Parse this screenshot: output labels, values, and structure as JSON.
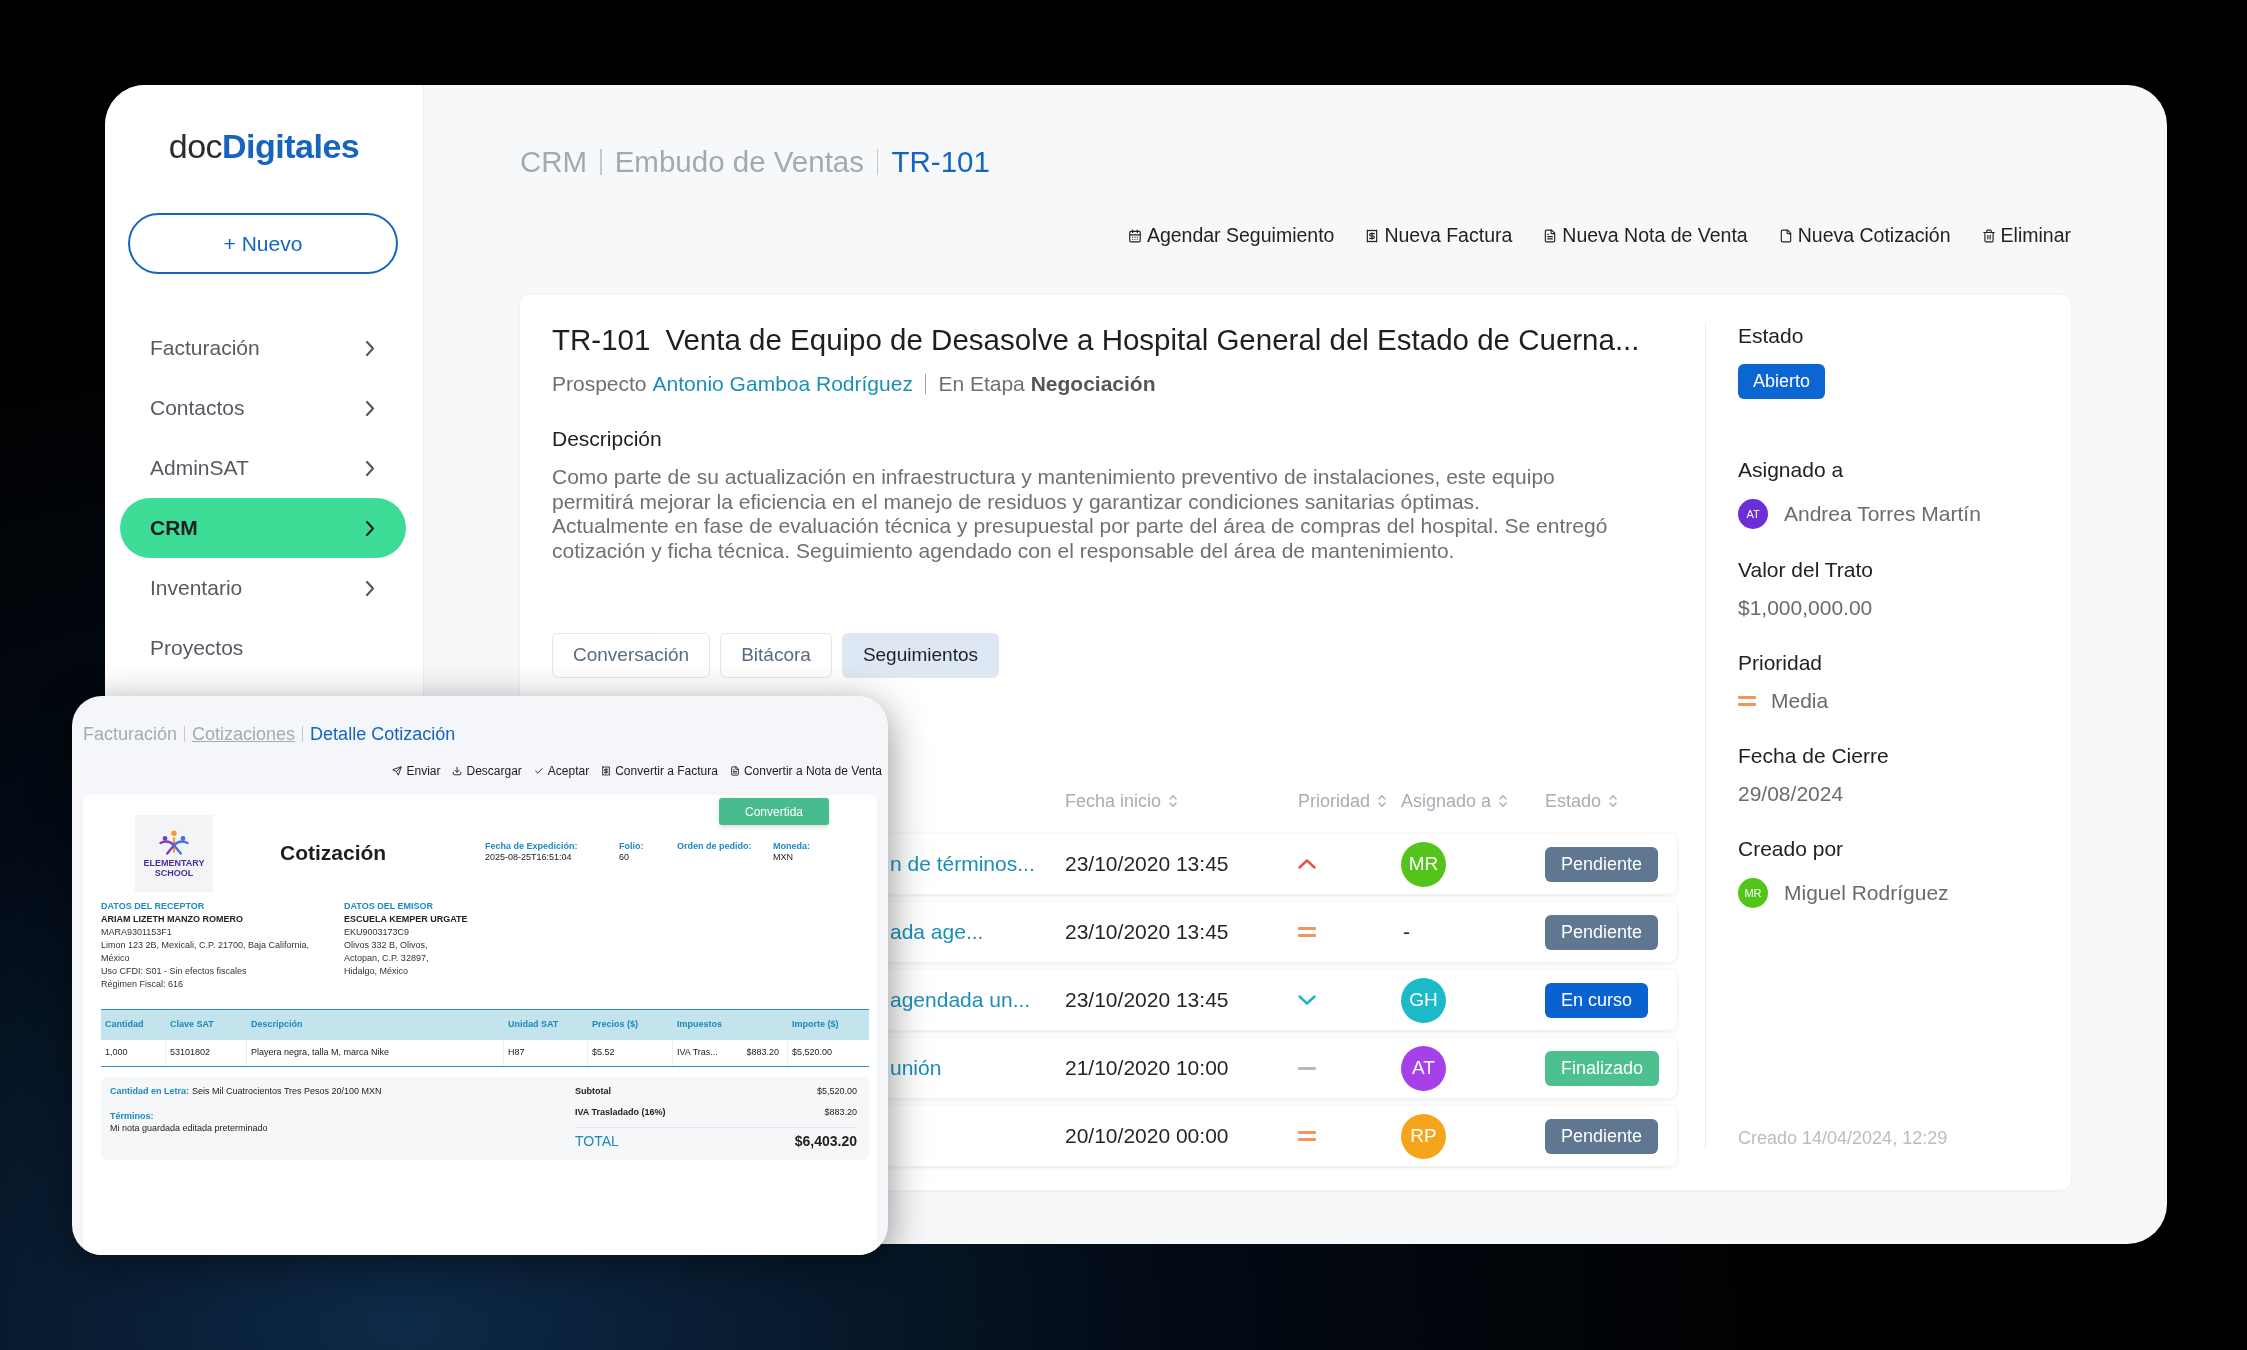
{
  "logo": {
    "text": "doc**Digitales**"
  },
  "new_button": {
    "label": "+ Nuevo"
  },
  "sidebar": {
    "items": [
      {
        "label": "Facturación",
        "submenu": true,
        "selected": false
      },
      {
        "label": "Contactos",
        "submenu": true,
        "selected": false
      },
      {
        "label": "AdminSAT",
        "submenu": true,
        "selected": false
      },
      {
        "label": "CRM",
        "submenu": true,
        "selected": true
      },
      {
        "label": "Inventario",
        "submenu": true,
        "selected": false
      },
      {
        "label": "Proyectos",
        "submenu": false,
        "selected": false
      }
    ]
  },
  "breadcrumb": [
    {
      "label": "CRM",
      "current": false
    },
    {
      "label": "Embudo de Ventas",
      "current": false
    },
    {
      "label": "TR-101",
      "current": true
    }
  ],
  "actions": [
    "Agendar Seguimiento",
    "Nueva Factura",
    "Nueva Nota de Venta",
    "Nueva Cotización",
    "Eliminar"
  ],
  "deal": {
    "code": "TR-101",
    "title": "Venta de Equipo de Desasolve a Hospital General del Estado de Cuerna...",
    "prospect_label": "Prospecto",
    "prospect": "Antonio Gamboa Rodríguez",
    "stage": "En Etapa **Negociación**",
    "description_label": "Descripción",
    "description": [
      "Como parte de su actualización en infraestructura y mantenimiento preventivo de instalaciones, este equipo permitirá mejorar la eficiencia en el manejo de residuos y garantizar condiciones sanitarias óptimas.",
      "Actualmente en fase de evaluación técnica y presupuestal por parte del área de compras del hospital. Se entregó cotización y ficha técnica. Seguimiento agendado con el responsable del área de mantenimiento."
    ]
  },
  "tabs": [
    {
      "label": "Conversación",
      "selected": false
    },
    {
      "label": "Bitácora",
      "selected": false
    },
    {
      "label": "Seguimientos",
      "selected": true
    }
  ],
  "followups": {
    "columns": [
      "Fecha inicio",
      "Prioridad",
      "Asignado a",
      "Estado"
    ],
    "rows": [
      {
        "title": "n de términos...",
        "start": "23/10/2020 13:45",
        "priority": {
          "kind": "high"
        },
        "assignee": {
          "kind": "avatar",
          "initials": "MR",
          "color": "#52c41a"
        },
        "status": {
          "label": "Pendiente",
          "color": "#5f7791"
        }
      },
      {
        "title": "ada age...",
        "start": "23/10/2020 13:45",
        "priority": {
          "kind": "medium"
        },
        "assignee": {
          "kind": "none",
          "text": "-"
        },
        "status": {
          "label": "Pendiente",
          "color": "#5f7791"
        }
      },
      {
        "title": "agendada un...",
        "start": "23/10/2020 13:45",
        "priority": {
          "kind": "low"
        },
        "assignee": {
          "kind": "avatar",
          "initials": "GH",
          "color": "#1cb9c8"
        },
        "status": {
          "label": "En curso",
          "color": "#0a62d0"
        }
      },
      {
        "title": "unión",
        "start": "21/10/2020 10:00",
        "priority": {
          "kind": "none"
        },
        "assignee": {
          "kind": "avatar",
          "initials": "AT",
          "color": "#a640e8"
        },
        "status": {
          "label": "Finalizado",
          "color": "#4cc08f"
        }
      },
      {
        "start": "20/10/2020 00:00",
        "priority": {
          "kind": "medium"
        },
        "assignee": {
          "kind": "avatar",
          "initials": "RP",
          "color": "#f5a51c"
        },
        "status": {
          "label": "Pendiente",
          "color": "#5f7791"
        }
      }
    ]
  },
  "details": {
    "fields": [
      {
        "kind": "status",
        "label": "Estado",
        "value": "Abierto"
      },
      {
        "kind": "person",
        "label": "Asignado a",
        "initials": "AT",
        "color": "#6c2fd6",
        "value": "Andrea Torres Martín"
      },
      {
        "kind": "text",
        "label": "Valor del Trato",
        "value": "$1,000,000.00"
      },
      {
        "kind": "priority",
        "label": "Prioridad",
        "priority": {
          "kind": "medium"
        },
        "value": "Media"
      },
      {
        "kind": "text",
        "label": "Fecha de Cierre",
        "value": "29/08/2024"
      },
      {
        "kind": "person",
        "label": "Creado por",
        "initials": "MR",
        "color": "#52c41a",
        "value": "Miguel Rodríguez"
      }
    ],
    "created": "Creado 14/04/2024, 12:29"
  },
  "quote_window": {
    "breadcrumb": [
      {
        "label": "Facturación",
        "kind": "plain"
      },
      {
        "label": "Cotizaciones",
        "kind": "link"
      },
      {
        "label": "Detalle Cotización",
        "kind": "current"
      }
    ],
    "actions": [
      "Enviar",
      "Descargar",
      "Aceptar",
      "Convertir a Factura",
      "Convertir a Nota de Venta"
    ],
    "status_button": "Convertida",
    "logo_text": "ELEMENTARY SCHOOL",
    "title": "Cotización",
    "meta": [
      {
        "label": "Fecha de Expedición:",
        "value": "2025-08-25T16:51:04"
      },
      {
        "label": "Folio:",
        "value": "60"
      },
      {
        "label": "Orden de pedido:"
      },
      {
        "label": "Moneda:",
        "value": "MXN"
      }
    ],
    "parties": [
      {
        "heading": "DATOS DEL RECEPTOR",
        "name": "ARIAM LIZETH MANZO ROMERO",
        "lines": [
          "MARA9301153F1",
          "Limon 123 2B, Mexicali, C.P. 21700, Baja California, México",
          "Uso CFDI: S01 - Sin efectos fiscales",
          "Régimen Fiscal: 616"
        ]
      },
      {
        "heading": "DATOS DEL EMISOR",
        "name": "ESCUELA KEMPER URGATE",
        "lines": [
          "EKU9003173C9",
          "Olivos 332 B, Olivos, Actopan, C.P. 32897, Hidalgo, México"
        ]
      }
    ],
    "items": {
      "columns": [
        "Cantidad",
        "Clave SAT",
        "Descripción",
        "Unidad SAT",
        "Precios ($)",
        "Impuestos",
        "Importe ($)"
      ],
      "rows": [
        {
          "quantity": "1,000",
          "sat_code": "53101802",
          "description": "Playera negra, talla M, marca Nike",
          "unit": "H87",
          "price": "$5.52",
          "tax": "IVA Tras...",
          "tax_amount": "$883.20",
          "amount": "$5,520.00"
        }
      ]
    },
    "amount_in_words_label": "Cantidad en Letra:",
    "amount_in_words": "Seis Mil Cuatrocientos Tres Pesos 20/100 MXN",
    "terms_label": "Términos:",
    "terms": "Mi nota guardada editada preterminado",
    "totals": [
      {
        "kind": "line",
        "label": "Subtotal",
        "value": "$5,520.00"
      },
      {
        "kind": "line",
        "label": "IVA Trasladado (16%)",
        "value": "$883.20"
      },
      {
        "kind": "total",
        "label": "TOTAL",
        "value": "$6,403.20"
      }
    ]
  }
}
